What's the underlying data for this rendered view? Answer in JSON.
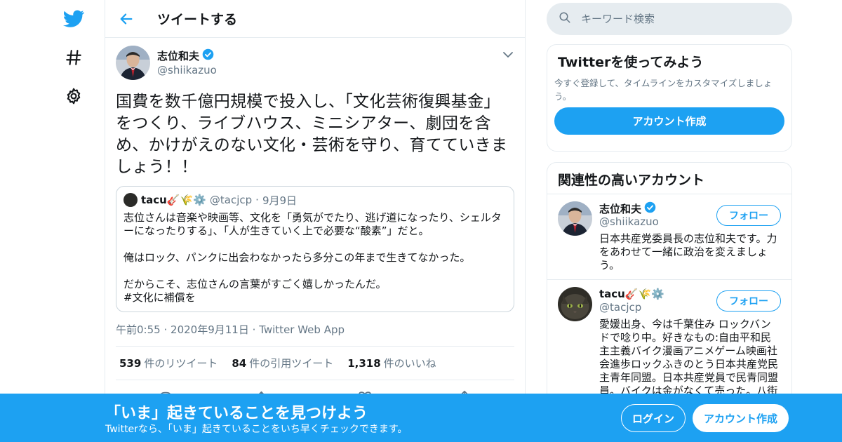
{
  "colors": {
    "brand": "#1da1f2",
    "secondary_text": "#657786",
    "border": "#e6ecf0"
  },
  "nav": {
    "items": [
      {
        "icon": "twitter-bird-icon"
      },
      {
        "icon": "hashtag-icon"
      },
      {
        "icon": "gear-icon"
      }
    ]
  },
  "header": {
    "back_icon": "arrow-left-icon",
    "title": "ツイートする"
  },
  "tweet": {
    "author_name": "志位和夫",
    "verified": true,
    "author_handle": "@shiikazuo",
    "text": "国費を数千億円規模で投入し、「文化芸術復興基金」をつくり、ライブハウス、ミニシアター、劇団を含め、かけがえのない文化・芸術を守り、育てていきましょう！！",
    "quote": {
      "author_name": "tacu🎸🌾⚙️",
      "author_handle": "@tacjcp",
      "separator": "·",
      "date": "9月9日",
      "lines": [
        "志位さんは音楽や映画等、文化を「勇気がでたり、逃げ道になったり、シェルターになったりする」、「人が生きていく上で必要な“酸素”」だと。",
        "",
        "俺はロック、パンクに出会わなかったら多分この年まで生きてなかった。",
        "",
        "だからこそ、志位さんの言葉がすごく嬉しかったんだ。",
        "#文化に補償を"
      ]
    },
    "time": "午前0:55",
    "date": "2020年9月11日",
    "source": "Twitter Web App",
    "dot": "·",
    "stats": {
      "retweets": "539",
      "retweets_label": "件のリツイート",
      "quotes": "84",
      "quotes_label": "件の引用ツイート",
      "likes": "1,318",
      "likes_label": "件のいいね"
    },
    "actions": [
      "reply-icon",
      "retweet-icon",
      "like-icon",
      "share-icon"
    ]
  },
  "search": {
    "placeholder": "キーワード検索"
  },
  "signup_card": {
    "title": "Twitterを使ってみよう",
    "subtitle": "今すぐ登録して、タイムラインをカスタマイズしましょう。",
    "button": "アカウント作成"
  },
  "related": {
    "title": "関連性の高いアカウント",
    "accounts": [
      {
        "name": "志位和夫",
        "verified": true,
        "handle": "@shiikazuo",
        "bio": "日本共産党委員長の志位和夫です。力をあわせて一緒に政治を変えましょう。",
        "follow": "フォロー"
      },
      {
        "name": "tacu🎸🌾⚙️",
        "verified": false,
        "handle": "@tacjcp",
        "bio": "愛媛出身、今は千葉住み ロックバンドで唸り中。好きなもの:自由平和民主主義バイク漫画アニメゲーム映画社会進歩ロックふきのとう日本共産党民主青年同盟。日本共産党員で民青同盟員。バイクは金がなくて売った。八街",
        "follow": "フォロー"
      }
    ]
  },
  "banner": {
    "title": "「いま」起きていることを見つけよう",
    "subtitle": "Twitterなら、「いま」起きていることをいち早くチェックできます。",
    "login": "ログイン",
    "signup": "アカウント作成"
  }
}
